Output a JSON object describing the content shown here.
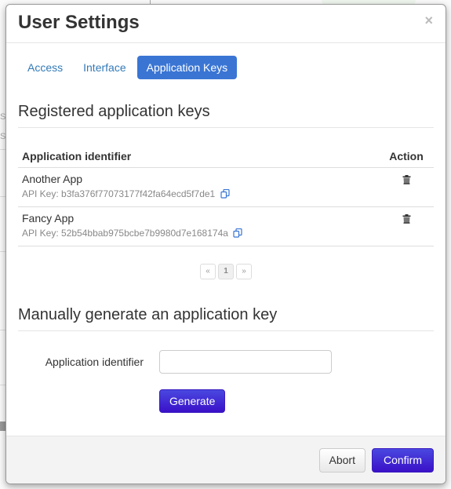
{
  "modal": {
    "title": "User Settings",
    "close_symbol": "×"
  },
  "tabs": [
    {
      "label": "Access",
      "active": false
    },
    {
      "label": "Interface",
      "active": false
    },
    {
      "label": "Application Keys",
      "active": true
    }
  ],
  "registered": {
    "title": "Registered application keys",
    "columns": {
      "identifier": "Application identifier",
      "action": "Action"
    },
    "rows": [
      {
        "name": "Another App",
        "api_key_label": "API Key: b3fa376f77073177f42fa64ecd5f7de1",
        "action_icon": "trash-icon",
        "copy_icon": "copy-icon"
      },
      {
        "name": "Fancy App",
        "api_key_label": "API Key: 52b54bbab975bcbe7b9980d7e168174a",
        "action_icon": "trash-icon",
        "copy_icon": "copy-icon"
      }
    ],
    "pagination": {
      "prev": "«",
      "current": "1",
      "next": "»"
    }
  },
  "generate": {
    "title": "Manually generate an application key",
    "field_label": "Application identifier",
    "field_value": "",
    "field_placeholder": "",
    "button_label": "Generate"
  },
  "footer": {
    "abort_label": "Abort",
    "confirm_label": "Confirm"
  },
  "colors": {
    "tab_active": "#3a75d4",
    "link": "#337ab7",
    "primary_button": "#3a10c8"
  },
  "background": {
    "fragments": [
      "S",
      "S"
    ]
  }
}
